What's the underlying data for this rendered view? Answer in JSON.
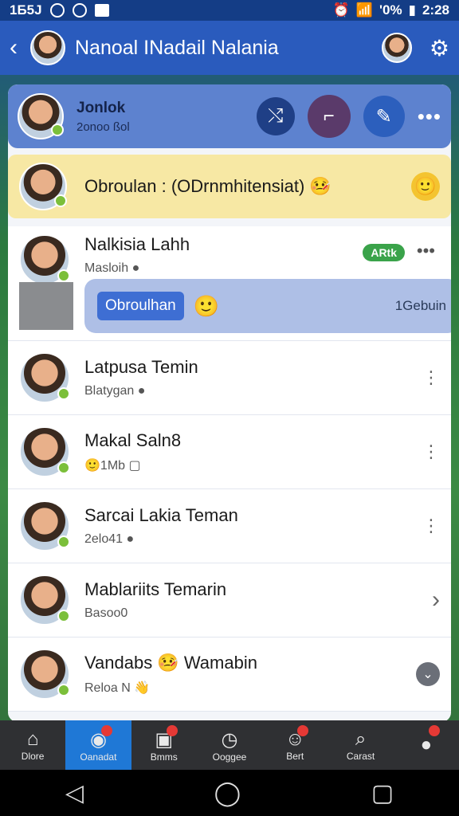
{
  "statusbar": {
    "left_text": "1Б5Ј",
    "right_battery": "'0%",
    "time": "2:28"
  },
  "appbar": {
    "back_icon": "chevron-left-icon",
    "title": "Nanoal INadail Nalania",
    "settings_icon": "gear-icon"
  },
  "profile": {
    "name": "Jonlok",
    "sub": "2onoo ßol",
    "actions": [
      "shuffle-icon",
      "note-icon",
      "edit-icon",
      "more-icon"
    ]
  },
  "banner": {
    "text": "Obroulan : (ODrnmhitensiat) 🤒",
    "emoji": "🙂"
  },
  "contacts": [
    {
      "name": "Nalkisia Lahh",
      "sub": "Masloih ●",
      "pill": "ARtk",
      "bubble_button": "Obroulhan",
      "bubble_emoji": "🙂",
      "bubble_right": "1Gebuin"
    },
    {
      "name": "Latpusa Temin",
      "sub": "Blatygan ●"
    },
    {
      "name": "Makal Saln8",
      "sub": "🙂1Mb ▢"
    },
    {
      "name": "Sarcai Lakia Teman",
      "sub": "2elo41 ●"
    },
    {
      "name": "Mablariits Temarin",
      "sub": "Basoo0"
    },
    {
      "name": "Vandabs 🤒 Wamabin",
      "sub": "Reloa N 👋"
    }
  ],
  "bottom_nav": [
    {
      "label": "Dlore",
      "icon": "home-icon"
    },
    {
      "label": "Oanadat",
      "icon": "chat-icon",
      "active": true
    },
    {
      "label": "Bmms",
      "icon": "calendar-icon"
    },
    {
      "label": "Ooggee",
      "icon": "clock-icon"
    },
    {
      "label": "Bert",
      "icon": "group-icon"
    },
    {
      "label": "Carast",
      "icon": "search-user-icon"
    },
    {
      "label": "",
      "icon": "profile-icon"
    }
  ],
  "colors": {
    "accent": "#2a5bbd",
    "banner": "#f7e8a4",
    "online": "#3aa34a",
    "nav_active": "#1f78d6"
  }
}
